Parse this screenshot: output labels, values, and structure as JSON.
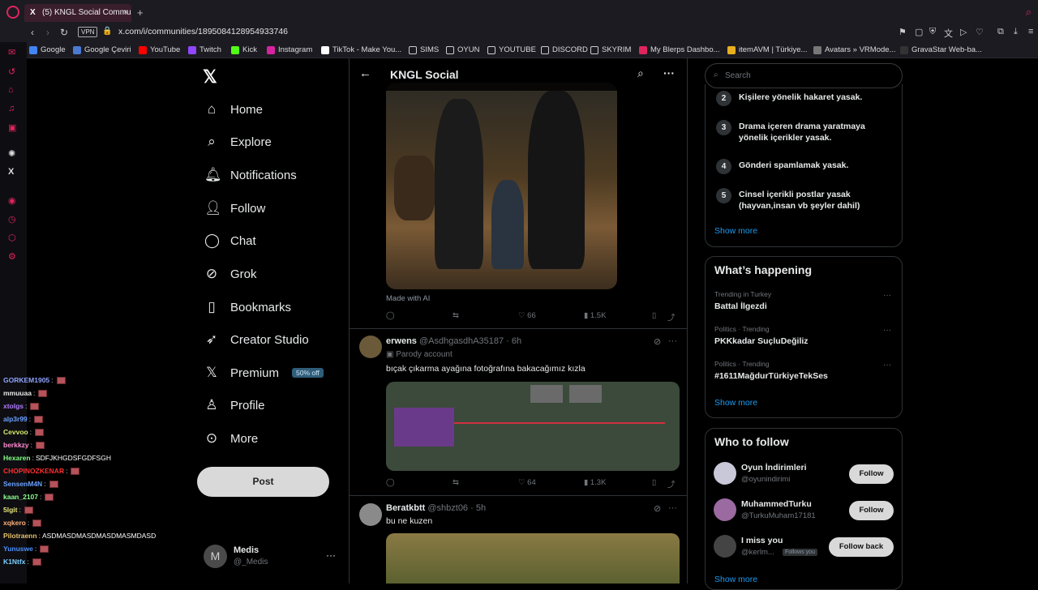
{
  "browser": {
    "tab_title": "(5) KNGL Social Communi",
    "tab_fav": "X",
    "close": "×",
    "newtab": "+",
    "vpn": "VPN",
    "url": "x.com/i/communities/1895084128954933746",
    "bookmarks": [
      "Google",
      "Google Çeviri",
      "YouTube",
      "Twitch",
      "Kick",
      "Instagram",
      "TikTok - Make You...",
      "SIMS",
      "OYUN",
      "YOUTUBE",
      "DISCORD",
      "SKYRIM",
      "My Blerps Dashbo...",
      "itemAVM | Türkiye...",
      "Avatars » VRMode...",
      "GravaStar Web-ba..."
    ]
  },
  "nav": {
    "items": [
      "Home",
      "Explore",
      "Notifications",
      "Follow",
      "Chat",
      "Grok",
      "Bookmarks",
      "Creator Studio",
      "Premium",
      "Profile",
      "More"
    ],
    "premium_badge": "50% off",
    "post": "Post",
    "me_initial": "M",
    "me_name": "Medis",
    "me_handle": "@_Medis",
    "more_dots": "···"
  },
  "chat": [
    {
      "user": "GORKEM1905",
      "msg": "",
      "color": "#8fa3ff"
    },
    {
      "user": "mmuuaa",
      "msg": "",
      "color": "#e8e8e8"
    },
    {
      "user": "xtolgs",
      "msg": "",
      "color": "#b07cff"
    },
    {
      "user": "alp3r99",
      "msg": "",
      "color": "#6aa0ff"
    },
    {
      "user": "Cevvoo",
      "msg": "",
      "color": "#d8e86a"
    },
    {
      "user": "berkkzy",
      "msg": "",
      "color": "#ff8ad0"
    },
    {
      "user": "Hexaren",
      "msg": "SDFJKHGDSFGDFSGH",
      "color": "#7fff7f"
    },
    {
      "user": "CHOPINOZKENAR",
      "msg": "",
      "color": "#ff3030"
    },
    {
      "user": "SensenM4N",
      "msg": "",
      "color": "#6aa0ff"
    },
    {
      "user": "kaan_2107",
      "msg": "",
      "color": "#8cff8c"
    },
    {
      "user": "5lgit",
      "msg": "",
      "color": "#e8e87a"
    },
    {
      "user": "xqkero",
      "msg": "",
      "color": "#ffb07a"
    },
    {
      "user": "Pilotraenn",
      "msg": "ASDMASDMASDMASDMASMDASD",
      "color": "#e8c06a"
    },
    {
      "user": "Yunuswe",
      "msg": "",
      "color": "#4a90ff"
    },
    {
      "user": "K1Ntfx",
      "msg": "",
      "color": "#7ad0ff"
    }
  ],
  "feed": {
    "title": "KNGL Social",
    "post1": {
      "made_ai": "Made with AI",
      "likes": "66",
      "views": "1.5K"
    },
    "post2": {
      "name": "erwens",
      "handle": "@AsdhgasdhA35187 · 6h",
      "parody": "Parody account",
      "text": "bıçak çıkarma ayağına fotoğrafına bakacağımız kızla",
      "likes": "64",
      "views": "1.3K"
    },
    "post3": {
      "name": "Beratkbtt",
      "handle": "@shbzt06 · 5h",
      "text": "bu ne kuzen"
    }
  },
  "right": {
    "search_placeholder": "Search",
    "rules": [
      {
        "n": "2",
        "t": "Kişilere yönelik hakaret yasak."
      },
      {
        "n": "3",
        "t": "Drama içeren drama yaratmaya yönelik içerikler yasak."
      },
      {
        "n": "4",
        "t": "Gönderi spamlamak yasak."
      },
      {
        "n": "5",
        "t": "Cinsel içerikli postlar yasak (hayvan,insan vb şeyler dahil)"
      }
    ],
    "show_more": "Show more",
    "happening_title": "What’s happening",
    "trends": [
      {
        "meta": "Trending in Turkey",
        "name": "Battal İlgezdi"
      },
      {
        "meta": "Politics · Trending",
        "name": "PKKkadar SuçluDeğiliz"
      },
      {
        "meta": "Politics · Trending",
        "name": "#1611MağdurTürkiyeTekSes"
      }
    ],
    "wtf_title": "Who to follow",
    "wtf": [
      {
        "name": "Oyun İndirimleri",
        "handle": "@oyunindirimi",
        "btn": "Follow"
      },
      {
        "name": "MuhammedTurku",
        "handle": "@TurkuMuham17181",
        "btn": "Follow"
      },
      {
        "name": "I miss you",
        "handle": "@kerlm...",
        "btn": "Follow back",
        "follows_you": "Follows you"
      }
    ]
  }
}
